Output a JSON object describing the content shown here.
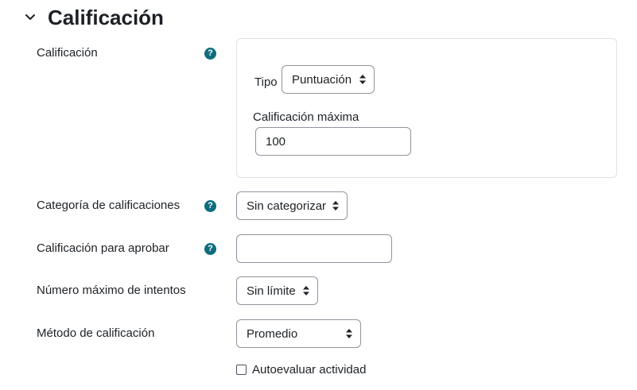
{
  "section": {
    "title": "Calificación",
    "chevron_icon": "chevron-down-icon"
  },
  "grade": {
    "label": "Calificación",
    "help_icon": "question-circle-icon",
    "type_label": "Tipo",
    "type_value": "Puntuación",
    "max_grade_label": "Calificación máxima",
    "max_grade_value": "100"
  },
  "grade_category": {
    "label": "Categoría de calificaciones",
    "value": "Sin categorizar"
  },
  "grade_to_pass": {
    "label": "Calificación para aprobar",
    "value": ""
  },
  "max_attempts": {
    "label": "Número máximo de intentos",
    "value": "Sin límite"
  },
  "grading_method": {
    "label": "Método de calificación",
    "value": "Promedio"
  },
  "self_assessment": {
    "label": "Autoevaluar actividad",
    "checked": false
  },
  "colors": {
    "help_icon_bg": "#0f6c7e",
    "text": "#1d2125",
    "input_border": "#8f959e",
    "box_border": "#dee2e6"
  }
}
